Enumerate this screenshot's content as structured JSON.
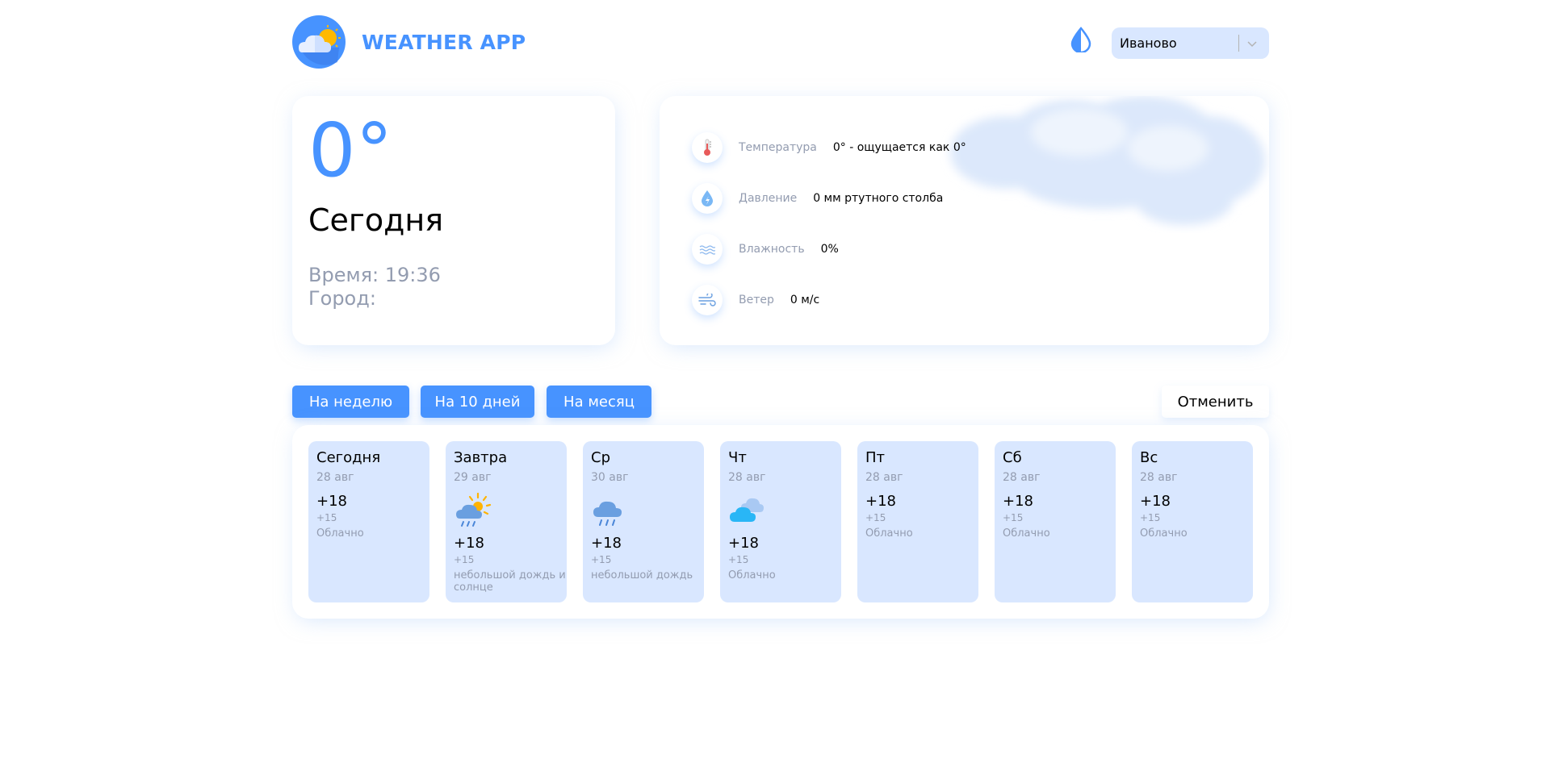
{
  "app": {
    "title": "WEATHER APP",
    "accent_color": "#4793ff",
    "card_bg_color": "#d9e7ff",
    "muted_text_color": "#939cb0"
  },
  "header": {
    "logo_icon": "cloud-sun-logo",
    "theme_icon": "drop-half-icon",
    "city_select": {
      "value": "Иваново",
      "chevron_icon": "chevron-down-icon"
    }
  },
  "today": {
    "temp": "0°",
    "label": "Сегодня",
    "time": "Время: 19:36",
    "city": "Город:"
  },
  "details": [
    {
      "icon": "thermometer-icon",
      "label": "Температура",
      "value": "0° - ощущается как 0°"
    },
    {
      "icon": "pressure-drop-icon",
      "label": "Давление",
      "value": "0 мм ртутного столба"
    },
    {
      "icon": "humidity-waves-icon",
      "label": "Влажность",
      "value": "0%"
    },
    {
      "icon": "wind-icon",
      "label": "Ветер",
      "value": "0 м/с"
    }
  ],
  "tabs": [
    {
      "label": "На неделю"
    },
    {
      "label": "На 10 дней"
    },
    {
      "label": "На месяц"
    }
  ],
  "cancel_label": "Отменить",
  "forecast": [
    {
      "day": "Сегодня",
      "date": "28 авг",
      "icon": "",
      "temp": "+18",
      "temp_alt": "+15",
      "desc": "Облачно"
    },
    {
      "day": "Завтра",
      "date": "29 авг",
      "icon": "rain-sun-icon",
      "temp": "+18",
      "temp_alt": "+15",
      "desc": "небольшой дождь и солнце"
    },
    {
      "day": "Ср",
      "date": "30 авг",
      "icon": "rain-cloud-icon",
      "temp": "+18",
      "temp_alt": "+15",
      "desc": "небольшой дождь"
    },
    {
      "day": "Чт",
      "date": "28 авг",
      "icon": "clouds-icon",
      "temp": "+18",
      "temp_alt": "+15",
      "desc": "Облачно"
    },
    {
      "day": "Пт",
      "date": "28 авг",
      "icon": "",
      "temp": "+18",
      "temp_alt": "+15",
      "desc": "Облачно"
    },
    {
      "day": "Сб",
      "date": "28 авг",
      "icon": "",
      "temp": "+18",
      "temp_alt": "+15",
      "desc": "Облачно"
    },
    {
      "day": "Вс",
      "date": "28 авг",
      "icon": "",
      "temp": "+18",
      "temp_alt": "+15",
      "desc": "Облачно"
    }
  ]
}
